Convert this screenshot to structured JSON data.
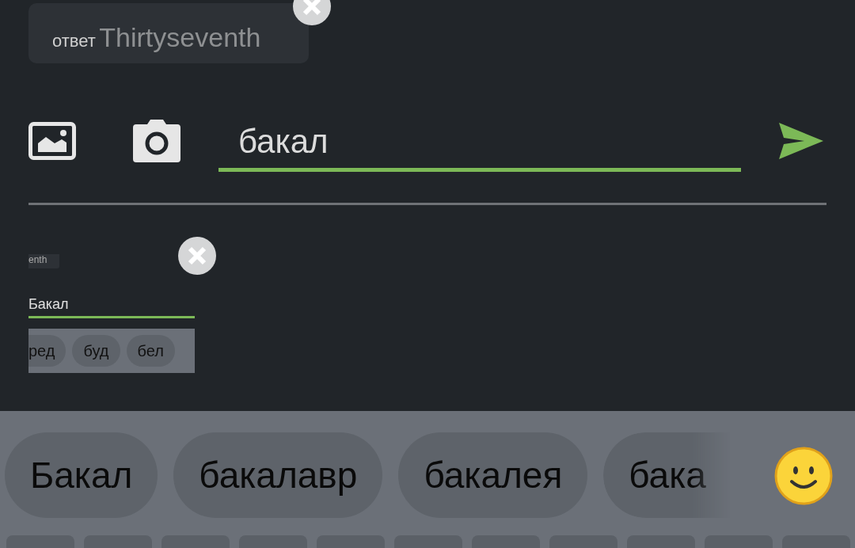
{
  "reply": {
    "prefix": "ответ",
    "name": "Thirtyseventh"
  },
  "composer": {
    "value": "бакал"
  },
  "attachment": {
    "preview": {
      "chip": "enth",
      "value": "Бакал",
      "suggestions": [
        "ред",
        "буд",
        "бел"
      ]
    }
  },
  "keyboard": {
    "suggestions": [
      "Бакал",
      "бакалавр",
      "бакалея",
      "бака"
    ]
  }
}
